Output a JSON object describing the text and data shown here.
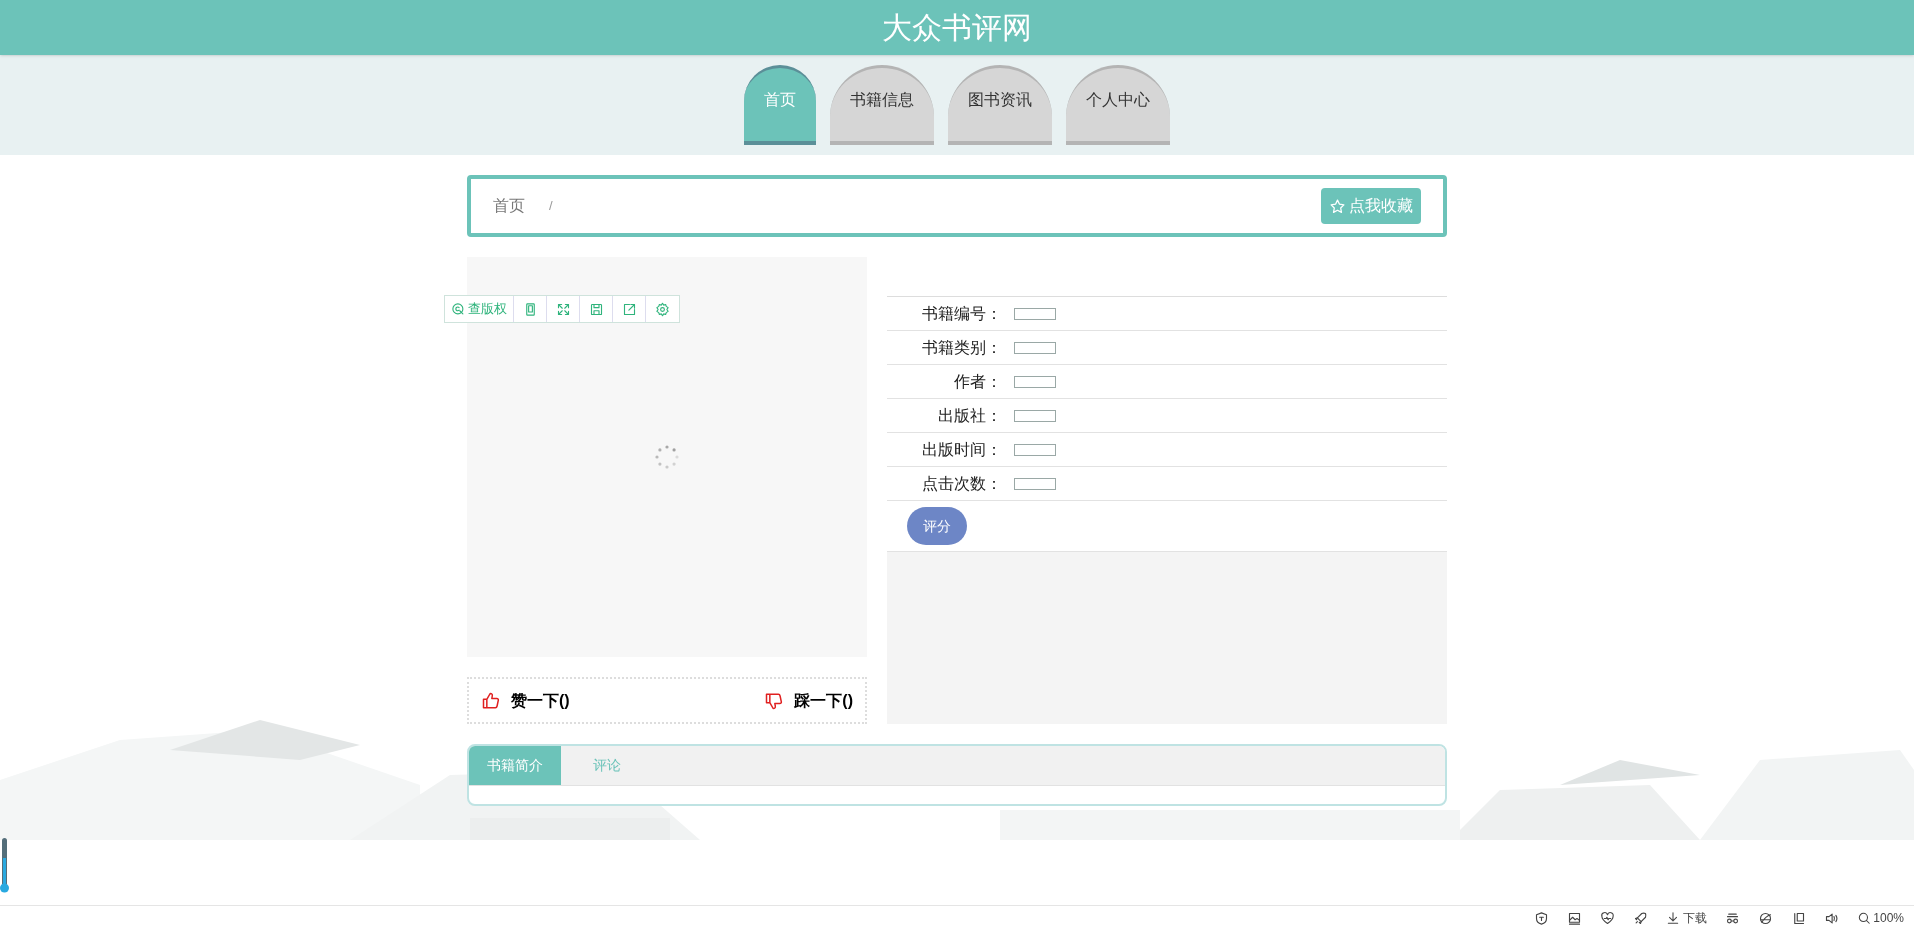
{
  "header": {
    "title": "大众书评网"
  },
  "nav": {
    "tabs": [
      {
        "label": "首页",
        "selected": true
      },
      {
        "label": "书籍信息",
        "selected": false
      },
      {
        "label": "图书资讯",
        "selected": false
      },
      {
        "label": "个人中心",
        "selected": false
      }
    ]
  },
  "breadcrumb": {
    "items": [
      "首页"
    ],
    "separator": "/"
  },
  "favorite_button": {
    "label": "点我收藏"
  },
  "image_toolbar": {
    "copyright_label": "查版权"
  },
  "book_info": {
    "rows": [
      {
        "label": "书籍编号："
      },
      {
        "label": "书籍类别："
      },
      {
        "label": "作者："
      },
      {
        "label": "出版社："
      },
      {
        "label": "出版时间："
      },
      {
        "label": "点击次数："
      }
    ],
    "rate_button": "评分"
  },
  "votes": {
    "like": "赞一下()",
    "dislike": "踩一下()"
  },
  "detail_tabs": [
    {
      "label": "书籍简介",
      "selected": true
    },
    {
      "label": "评论",
      "selected": false
    }
  ],
  "status_bar": {
    "download": "下载",
    "zoom": "100%"
  }
}
